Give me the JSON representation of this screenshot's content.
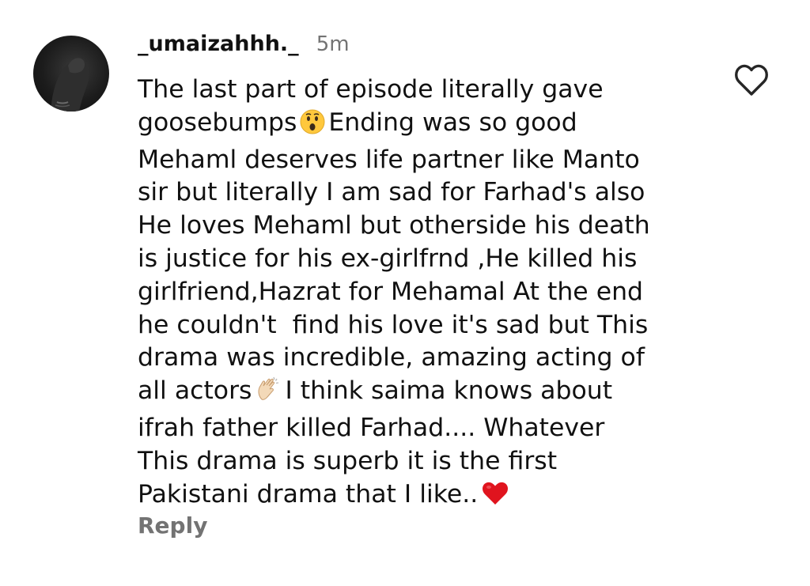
{
  "comment": {
    "username": "_umaizahhh._",
    "timestamp": "5m",
    "lines": [
      "The last part of episode literally gave",
      "goosebumps",
      "Ending was so good",
      "Mehaml deserves life partner like Manto",
      "sir but literally I am sad for Farhad's also",
      "He loves Mehaml but otherside his death",
      "is justice for his ex-girlfrnd ,He killed his",
      "girlfriend,Hazrat for Mehamal At the end",
      "he couldn't  find his love it's sad but This",
      "drama was incredible, amazing acting of",
      "all actors",
      "I think saima knows about",
      "ifrah father killed Farhad.... Whatever",
      "This drama is superb it is the first",
      "Pakistani drama that I like.."
    ],
    "emojis": {
      "astonished": "astonished-face-icon",
      "clapping": "clapping-hands-icon",
      "heart": "red-heart-icon"
    },
    "reply_label": "Reply",
    "like_icon": "heart-outline-icon"
  },
  "colors": {
    "text": "#111111",
    "secondary": "#737373",
    "heart_red": "#e0141e",
    "emoji_yellow": "#ffc83d"
  }
}
